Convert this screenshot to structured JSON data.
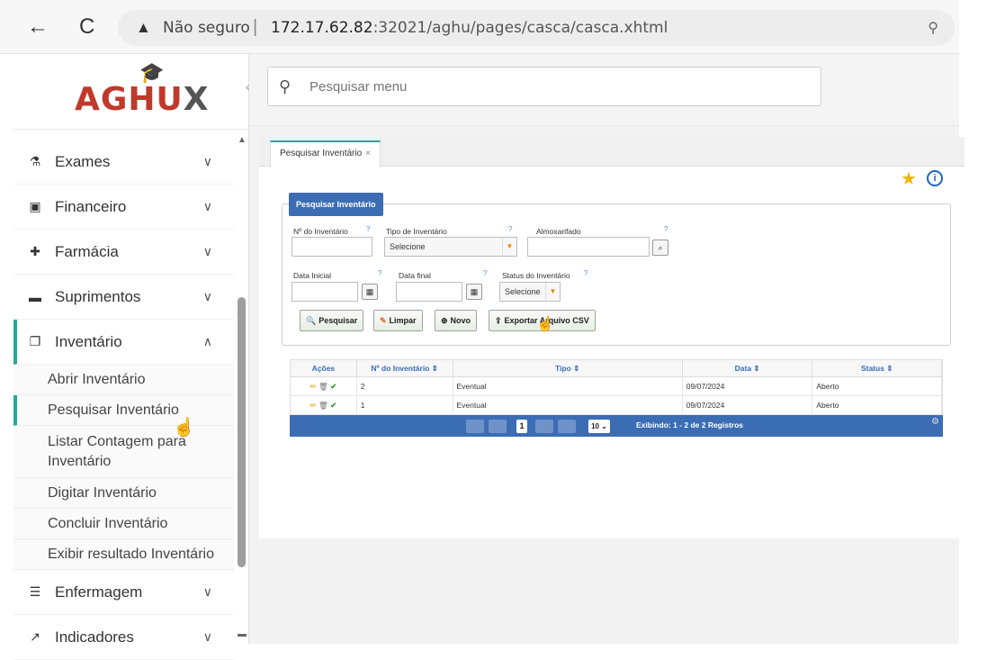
{
  "browser": {
    "back_icon": "←",
    "reload_icon": "C",
    "security_label": "Não seguro",
    "url_host": "172.17.62.82",
    "url_path": ":32021/aghu/pages/casca/casca.xhtml"
  },
  "sidebar": {
    "logo_main": "AGHU",
    "logo_x": "X",
    "items": [
      {
        "label": "Exames",
        "icon": "flask-icon"
      },
      {
        "label": "Financeiro",
        "icon": "money-icon"
      },
      {
        "label": "Farmácia",
        "icon": "plus-square-icon"
      },
      {
        "label": "Suprimentos",
        "icon": "archive-icon"
      },
      {
        "label": "Inventário",
        "icon": "copy-icon"
      }
    ],
    "sub_items": [
      "Abrir Inventário",
      "Pesquisar Inventário",
      "Listar Contagem para Inventário",
      "Digitar Inventário",
      "Concluir Inventário",
      "Exibir resultado Inventário"
    ],
    "bottom_items": [
      {
        "label": "Enfermagem",
        "icon": "list-icon"
      },
      {
        "label": "Indicadores",
        "icon": "chart-icon"
      }
    ]
  },
  "search": {
    "placeholder": "Pesquisar menu"
  },
  "tab": {
    "label": "Pesquisar Inventário"
  },
  "form": {
    "title": "Pesquisar Inventário",
    "num_label": "Nº do Inventário",
    "tipo_label": "Tipo de Inventário",
    "tipo_value": "Selecione",
    "almox_label": "Almoxarifado",
    "data_ini_label": "Data Inicial",
    "data_fim_label": "Data final",
    "status_label": "Status do Inventário",
    "status_value": "Selecione",
    "help": "?"
  },
  "buttons": {
    "pesquisar": "Pesquisar",
    "limpar": "Limpar",
    "novo": "Novo",
    "exportar": "Exportar Arquivo CSV"
  },
  "grid": {
    "headers": [
      "Ações",
      "Nº do Inventário ⇕",
      "Tipo ⇕",
      "Data ⇕",
      "Status ⇕"
    ],
    "rows": [
      {
        "num": "2",
        "tipo": "Eventual",
        "data": "09/07/2024",
        "status": "Aberto"
      },
      {
        "num": "1",
        "tipo": "Eventual",
        "data": "09/07/2024",
        "status": "Aberto"
      }
    ],
    "page": "1",
    "page_size": "10 ⌄",
    "summary": "Exibindo: 1 - 2 de 2 Registros"
  },
  "colors": {
    "accent": "#26a69a",
    "header_blue": "#3b6db5",
    "logo_red": "#c0392b"
  }
}
